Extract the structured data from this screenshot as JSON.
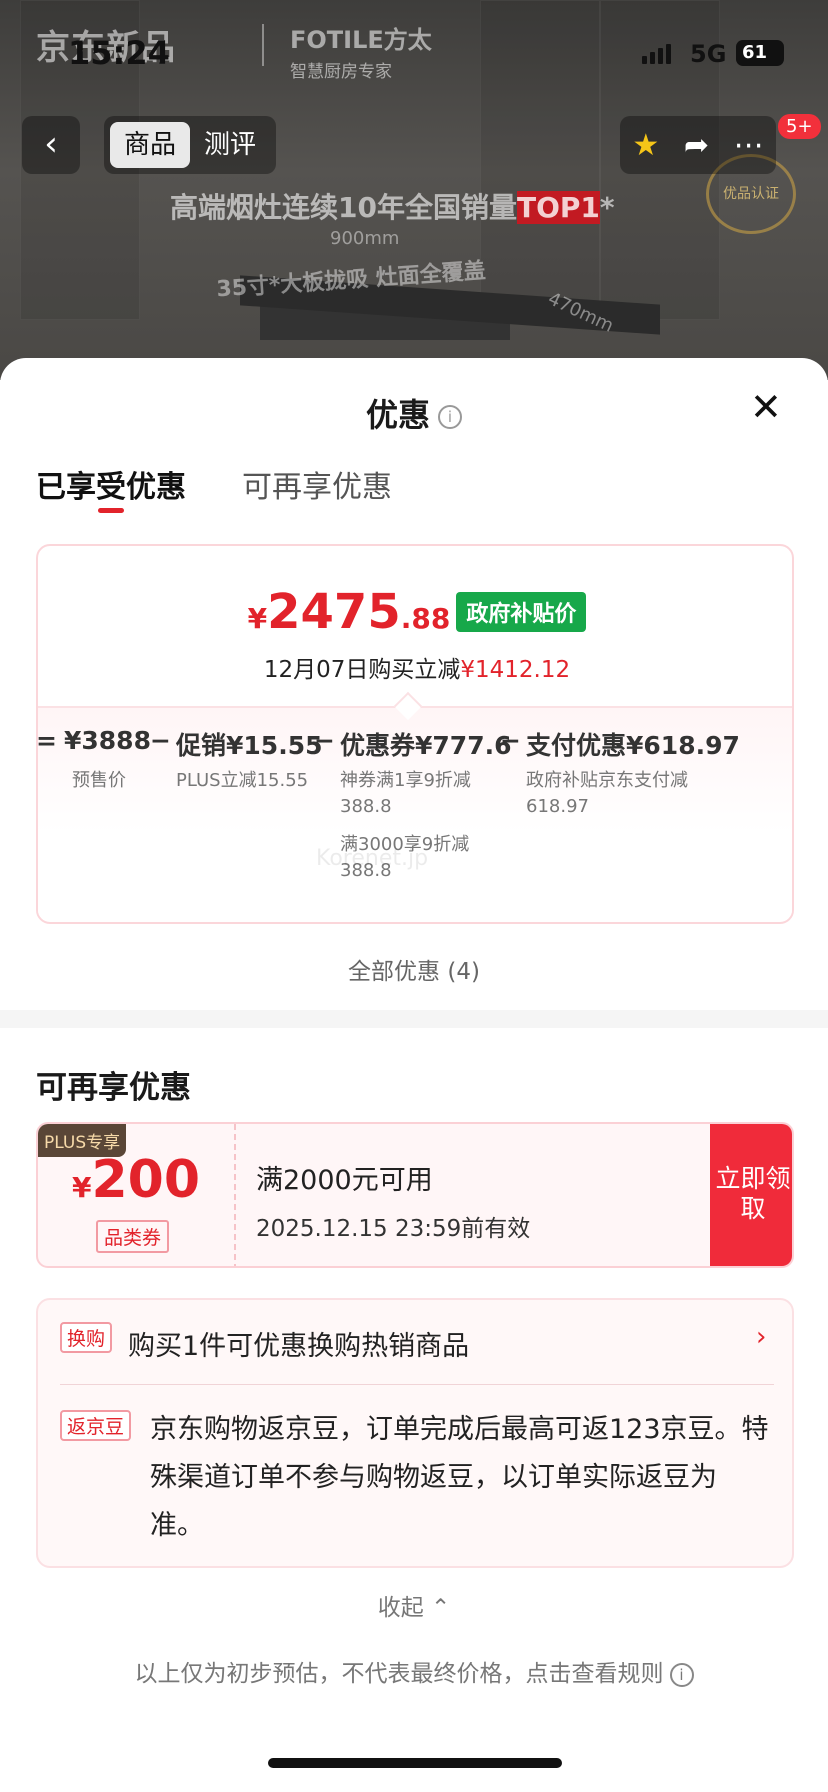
{
  "status_bar": {
    "time": "15:24",
    "network": "5G",
    "battery": "61"
  },
  "background": {
    "brand_left": "京东新品",
    "brand_right": "FOTILE方太",
    "brand_right_sub": "智慧厨房专家",
    "slogan_main": "高端烟灶连续10年全国销量",
    "slogan_highlight": "TOP1",
    "slogan_star": "*",
    "dim_width": "900mm",
    "dim_depth": "470mm",
    "feature": "35寸*大板拢吸 灶面全覆盖",
    "seal_text": "优品认证"
  },
  "nav": {
    "back": "‹",
    "tabs": [
      "商品",
      "测评"
    ],
    "active_tab": 0,
    "badge": "5+",
    "icons": [
      "star-icon",
      "share-icon",
      "more-icon"
    ]
  },
  "sheet": {
    "title": "优惠",
    "info": "i",
    "close": "✕",
    "tabs": [
      "已享受优惠",
      "可再享优惠"
    ],
    "price": {
      "yen": "¥",
      "integer": "2475",
      "decimal": ".88",
      "tag": "政府补贴价",
      "reduce_text": "12月07日购买立减",
      "reduce_amount": "¥1412.12"
    },
    "breakdown": [
      {
        "op": "=",
        "label": "",
        "amount": "¥3888",
        "subs": [
          "预售价"
        ]
      },
      {
        "op": "−",
        "label": "促销",
        "amount": "¥15.55",
        "subs": [
          "PLUS立减15.55"
        ]
      },
      {
        "op": "−",
        "label": "优惠券",
        "amount": "¥777.6",
        "subs": [
          "神券满1享9折减",
          "388.8",
          "满3000享9折减",
          "388.8"
        ]
      },
      {
        "op": "−",
        "label": "支付优惠",
        "amount": "¥618.97",
        "subs": [
          "政府补贴京东支付减",
          "618.97"
        ]
      }
    ],
    "watermark": "Korenet.jp",
    "all_discounts": "全部优惠 (4)",
    "more_title": "可再享优惠",
    "coupon": {
      "plus_tag": "PLUS专享",
      "yen": "¥",
      "amount": "200",
      "category": "品类券",
      "condition": "满2000元可用",
      "expiry": "2025.12.15 23:59前有效",
      "button": "立即领取"
    },
    "exchange": {
      "tag": "换购",
      "text": "购买1件可优惠换购热销商品",
      "chevron": "›"
    },
    "beans": {
      "tag": "返京豆",
      "text": "京东购物返京豆，订单完成后最高可返123京豆。特殊渠道订单不参与购物返豆，以订单实际返豆为准。"
    },
    "collapse": "收起 ⌃",
    "footer": "以上仅为初步预估，不代表最终价格，点击查看规则"
  },
  "colors": {
    "accent": "#e2232b",
    "green": "#17a84a",
    "plus_bg": "#5a4637"
  }
}
